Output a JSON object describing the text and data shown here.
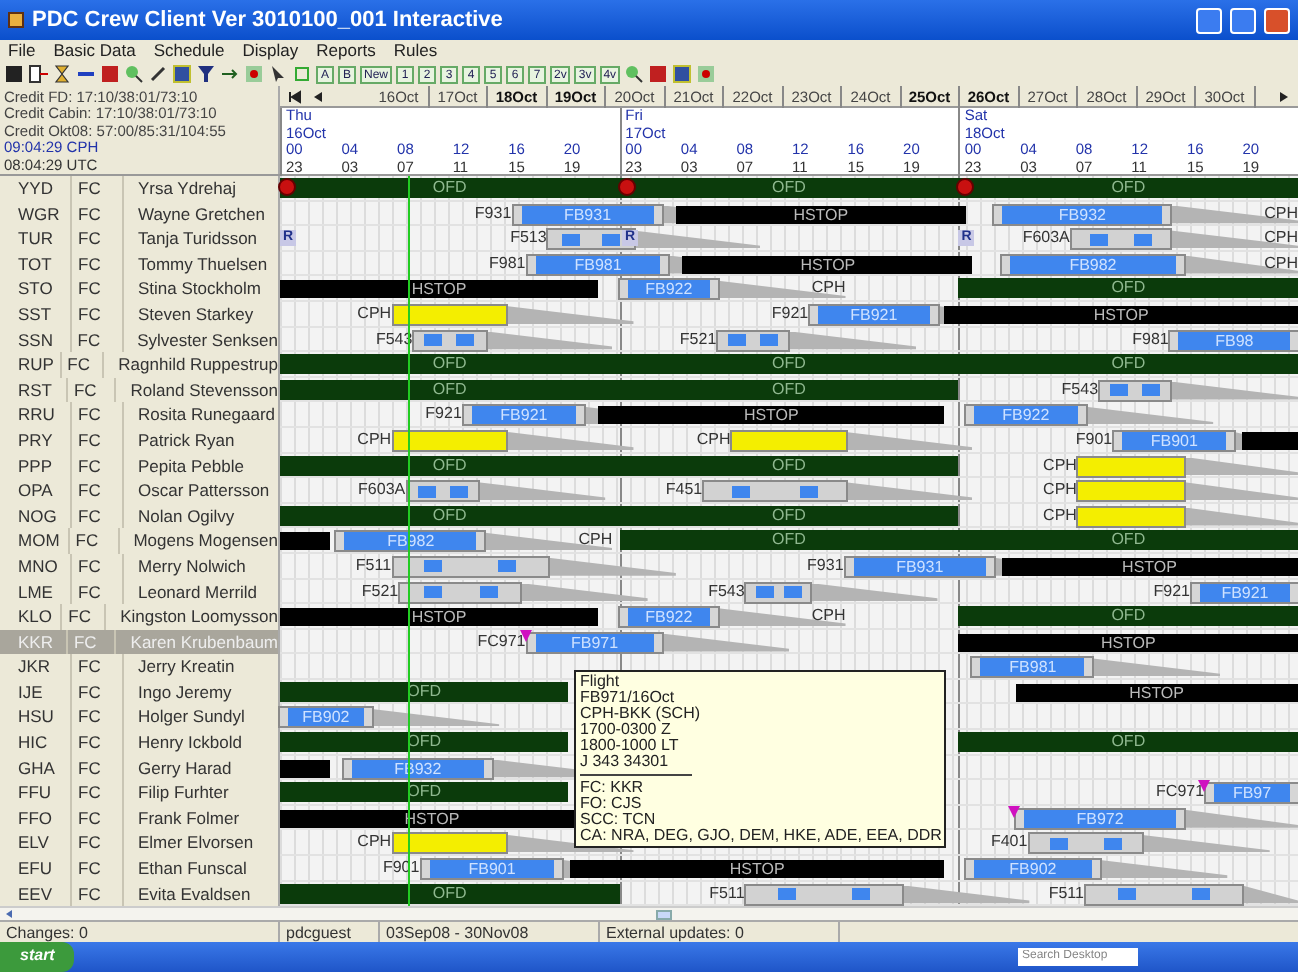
{
  "window": {
    "title": "PDC Crew Client Ver 3010100_001 Interactive"
  },
  "menu": [
    "File",
    "Basic Data",
    "Schedule",
    "Display",
    "Reports",
    "Rules"
  ],
  "toolbar": {
    "buttons": [
      "A",
      "B",
      "New",
      "1",
      "2",
      "3",
      "4",
      "5",
      "6",
      "7",
      "2v",
      "3v",
      "4v"
    ]
  },
  "info": {
    "lines": [
      "Credit FD: 17:10/38:01/73:10",
      "Credit Cabin: 17:10/38:01/73:10",
      "Credit Okt08: 57:00/85:31/104:55"
    ],
    "local_time": "09:04:29 CPH",
    "utc_time": "08:04:29 UTC"
  },
  "date_tabs": [
    {
      "label": "16Oct",
      "weekend": false
    },
    {
      "label": "17Oct",
      "weekend": false
    },
    {
      "label": "18Oct",
      "weekend": true
    },
    {
      "label": "19Oct",
      "weekend": true
    },
    {
      "label": "20Oct",
      "weekend": false
    },
    {
      "label": "21Oct",
      "weekend": false
    },
    {
      "label": "22Oct",
      "weekend": false
    },
    {
      "label": "23Oct",
      "weekend": false
    },
    {
      "label": "24Oct",
      "weekend": false
    },
    {
      "label": "25Oct",
      "weekend": true
    },
    {
      "label": "26Oct",
      "weekend": true
    },
    {
      "label": "27Oct",
      "weekend": false
    },
    {
      "label": "28Oct",
      "weekend": false
    },
    {
      "label": "29Oct",
      "weekend": false
    },
    {
      "label": "30Oct",
      "weekend": false
    }
  ],
  "days": [
    {
      "weekday": "Thu",
      "date": "16Oct",
      "hours": [
        "00",
        "04",
        "08",
        "12",
        "16",
        "20"
      ],
      "utc": [
        "23",
        "03",
        "07",
        "11",
        "15",
        "19"
      ]
    },
    {
      "weekday": "Fri",
      "date": "17Oct",
      "hours": [
        "00",
        "04",
        "08",
        "12",
        "16",
        "20"
      ],
      "utc": [
        "23",
        "03",
        "07",
        "11",
        "15",
        "19"
      ]
    },
    {
      "weekday": "Sat",
      "date": "18Oct",
      "hours": [
        "00",
        "04",
        "08",
        "12",
        "16",
        "20"
      ],
      "utc": [
        "23",
        "03",
        "07",
        "11",
        "15",
        "19"
      ]
    }
  ],
  "rows": [
    {
      "code": "YYD",
      "rank": "FC",
      "name": "Yrsa Ydrehaj",
      "selected": false,
      "duties": [
        {
          "kind": "off",
          "label": "OFD",
          "alert": true
        },
        {
          "kind": "off",
          "label": "OFD",
          "alert": true
        },
        {
          "kind": "off",
          "label": "OFD",
          "alert": true
        }
      ]
    },
    {
      "code": "WGR",
      "rank": "FC",
      "name": "Wayne Gretchen",
      "selected": false,
      "duties": [
        {
          "kind": "flight",
          "prefix": "F931",
          "label": "FB931"
        },
        {
          "kind": "hstop",
          "label": "HSTOP"
        },
        {
          "kind": "flight",
          "label": "FB932",
          "suffix": "CPH"
        }
      ]
    },
    {
      "code": "TUR",
      "rank": "FC",
      "name": "Tanja Turidsson",
      "selected": false,
      "duties": [
        {
          "kind": "marker",
          "label": "R"
        },
        {
          "kind": "pairing",
          "prefix": "F513"
        },
        {
          "kind": "marker",
          "label": "R"
        },
        {
          "kind": "marker",
          "label": "R"
        },
        {
          "kind": "pairing",
          "prefix": "F603A",
          "suffix": "CPH"
        }
      ]
    },
    {
      "code": "TOT",
      "rank": "FC",
      "name": "Tommy Thuelsen",
      "selected": false,
      "duties": [
        {
          "kind": "flight",
          "prefix": "F981",
          "label": "FB981"
        },
        {
          "kind": "hstop",
          "label": "HSTOP"
        },
        {
          "kind": "flight",
          "label": "FB982",
          "suffix": "CPH"
        }
      ]
    },
    {
      "code": "STO",
      "rank": "FC",
      "name": "Stina Stockholm",
      "selected": false,
      "duties": [
        {
          "kind": "hstop",
          "label": "HSTOP"
        },
        {
          "kind": "flight",
          "label": "FB922",
          "suffix": "CPH"
        },
        {
          "kind": "off",
          "label": "OFD"
        }
      ]
    },
    {
      "code": "SST",
      "rank": "FC",
      "name": "Steven Starkey",
      "selected": false,
      "duties": [
        {
          "kind": "standby",
          "prefix": "CPH"
        },
        {
          "kind": "flight",
          "prefix": "F921",
          "label": "FB921"
        },
        {
          "kind": "hstop",
          "label": "HSTOP"
        }
      ]
    },
    {
      "code": "SSN",
      "rank": "FC",
      "name": "Sylvester Senksen",
      "selected": false,
      "duties": [
        {
          "kind": "pairing",
          "prefix": "F543"
        },
        {
          "kind": "pairing",
          "prefix": "F521"
        },
        {
          "kind": "flight",
          "prefix": "F981",
          "label": "FB98"
        }
      ]
    },
    {
      "code": "RUP",
      "rank": "FC",
      "name": "Ragnhild Ruppestrup",
      "selected": false,
      "duties": [
        {
          "kind": "off",
          "label": "OFD"
        },
        {
          "kind": "off",
          "label": "OFD"
        },
        {
          "kind": "off",
          "label": "OFD"
        }
      ]
    },
    {
      "code": "RST",
      "rank": "FC",
      "name": "Roland Stevensson",
      "selected": false,
      "duties": [
        {
          "kind": "off",
          "label": "OFD"
        },
        {
          "kind": "off",
          "label": "OFD"
        },
        {
          "kind": "pairing",
          "prefix": "F543"
        }
      ]
    },
    {
      "code": "RRU",
      "rank": "FC",
      "name": "Rosita Runegaard",
      "selected": false,
      "duties": [
        {
          "kind": "flight",
          "prefix": "F921",
          "label": "FB921"
        },
        {
          "kind": "hstop",
          "label": "HSTOP"
        },
        {
          "kind": "flight",
          "label": "FB922"
        }
      ]
    },
    {
      "code": "PRY",
      "rank": "FC",
      "name": "Patrick Ryan",
      "selected": false,
      "duties": [
        {
          "kind": "standby",
          "prefix": "CPH"
        },
        {
          "kind": "standby",
          "prefix": "CPH"
        },
        {
          "kind": "flight",
          "prefix": "F901",
          "label": "FB901"
        },
        {
          "kind": "block"
        }
      ]
    },
    {
      "code": "PPP",
      "rank": "FC",
      "name": "Pepita Pebble",
      "selected": false,
      "duties": [
        {
          "kind": "off",
          "label": "OFD"
        },
        {
          "kind": "off",
          "label": "OFD"
        },
        {
          "kind": "standby",
          "prefix": "CPH"
        }
      ]
    },
    {
      "code": "OPA",
      "rank": "FC",
      "name": "Oscar Pattersson",
      "selected": false,
      "duties": [
        {
          "kind": "pairing",
          "prefix": "F603A"
        },
        {
          "kind": "pairing",
          "prefix": "F451"
        },
        {
          "kind": "standby",
          "prefix": "CPH"
        }
      ]
    },
    {
      "code": "NOG",
      "rank": "FC",
      "name": "Nolan Ogilvy",
      "selected": false,
      "duties": [
        {
          "kind": "off",
          "label": "OFD"
        },
        {
          "kind": "off",
          "label": "OFD"
        },
        {
          "kind": "standby",
          "prefix": "CPH"
        }
      ]
    },
    {
      "code": "MOM",
      "rank": "FC",
      "name": "Mogens Mogensen",
      "selected": false,
      "duties": [
        {
          "kind": "block"
        },
        {
          "kind": "flight",
          "label": "FB982",
          "suffix": "CPH"
        },
        {
          "kind": "off",
          "label": "OFD"
        },
        {
          "kind": "off",
          "label": "OFD"
        }
      ]
    },
    {
      "code": "MNO",
      "rank": "FC",
      "name": "Merry Nolwich",
      "selected": false,
      "duties": [
        {
          "kind": "pairing",
          "prefix": "F511"
        },
        {
          "kind": "flight",
          "prefix": "F931",
          "label": "FB931"
        },
        {
          "kind": "hstop",
          "label": "HSTOP"
        }
      ]
    },
    {
      "code": "LME",
      "rank": "FC",
      "name": "Leonard Merrild",
      "selected": false,
      "duties": [
        {
          "kind": "pairing",
          "prefix": "F521"
        },
        {
          "kind": "pairing",
          "prefix": "F543"
        },
        {
          "kind": "flight",
          "prefix": "F921",
          "label": "FB921"
        }
      ]
    },
    {
      "code": "KLO",
      "rank": "FC",
      "name": "Kingston Loomysson",
      "selected": false,
      "duties": [
        {
          "kind": "hstop",
          "label": "HSTOP"
        },
        {
          "kind": "flight",
          "label": "FB922",
          "suffix": "CPH"
        },
        {
          "kind": "off",
          "label": "OFD"
        }
      ]
    },
    {
      "code": "KKR",
      "rank": "FC",
      "name": "Karen Krubenbaum",
      "selected": true,
      "duties": [
        {
          "kind": "flight",
          "prefix": "FC971",
          "label": "FB971",
          "flag": true
        },
        {
          "kind": "hstop",
          "label": "HSTOP"
        }
      ]
    },
    {
      "code": "JKR",
      "rank": "FC",
      "name": "Jerry Kreatin",
      "selected": false,
      "duties": [
        {
          "kind": "flight",
          "label": "FB981"
        }
      ]
    },
    {
      "code": "IJE",
      "rank": "FC",
      "name": "Ingo Jeremy",
      "selected": false,
      "duties": [
        {
          "kind": "off",
          "label": "OFD"
        },
        {
          "kind": "hstop",
          "label": "HSTOP"
        }
      ]
    },
    {
      "code": "HSU",
      "rank": "FC",
      "name": "Holger Sundyl",
      "selected": false,
      "duties": [
        {
          "kind": "flight",
          "label": "FB902"
        }
      ]
    },
    {
      "code": "HIC",
      "rank": "FC",
      "name": "Henry Ickbold",
      "selected": false,
      "duties": [
        {
          "kind": "off",
          "label": "OFD"
        },
        {
          "kind": "off",
          "label": "OFD"
        }
      ]
    },
    {
      "code": "GHA",
      "rank": "FC",
      "name": "Gerry Harad",
      "selected": false,
      "duties": [
        {
          "kind": "block"
        },
        {
          "kind": "flight",
          "label": "FB932"
        }
      ]
    },
    {
      "code": "FFU",
      "rank": "FC",
      "name": "Filip Furhter",
      "selected": false,
      "duties": [
        {
          "kind": "off",
          "label": "OFD"
        },
        {
          "kind": "flight",
          "prefix": "FC971",
          "label": "FB97",
          "flag": true
        }
      ]
    },
    {
      "code": "FFO",
      "rank": "FC",
      "name": "Frank Folmer",
      "selected": false,
      "duties": [
        {
          "kind": "hstop",
          "label": "HSTOP"
        },
        {
          "kind": "flight",
          "label": "FB972",
          "flag": true
        }
      ]
    },
    {
      "code": "ELV",
      "rank": "FC",
      "name": "Elmer Elvorsen",
      "selected": false,
      "duties": [
        {
          "kind": "standby",
          "prefix": "CPH"
        },
        {
          "kind": "pairing",
          "prefix": "F401"
        }
      ]
    },
    {
      "code": "EFU",
      "rank": "FC",
      "name": "Ethan Funscal",
      "selected": false,
      "duties": [
        {
          "kind": "flight",
          "prefix": "F901",
          "label": "FB901"
        },
        {
          "kind": "hstop",
          "label": "HSTOP"
        },
        {
          "kind": "flight",
          "label": "FB902"
        }
      ]
    },
    {
      "code": "EEV",
      "rank": "FC",
      "name": "Evita Evaldsen",
      "selected": false,
      "duties": [
        {
          "kind": "off",
          "label": "OFD"
        },
        {
          "kind": "pairing",
          "prefix": "F511"
        },
        {
          "kind": "pairing",
          "prefix": "F511"
        }
      ]
    }
  ],
  "tooltip": {
    "lines": [
      "Flight",
      "FB971/16Oct",
      "CPH-BKK (SCH)",
      "1700-0300 Z",
      "1800-1000 LT",
      "J 343 34301"
    ],
    "crew": [
      "FC: KKR",
      "FO: CJS",
      "SCC: TCN",
      "CA: NRA, DEG, GJO, DEM, HKE, ADE, EEA, DDR"
    ]
  },
  "status_bar": [
    "Changes: 0",
    "pdcguest",
    "03Sep08 - 30Nov08",
    "External updates: 0"
  ],
  "taskbar": {
    "start": "start",
    "search_placeholder": "Search Desktop"
  }
}
